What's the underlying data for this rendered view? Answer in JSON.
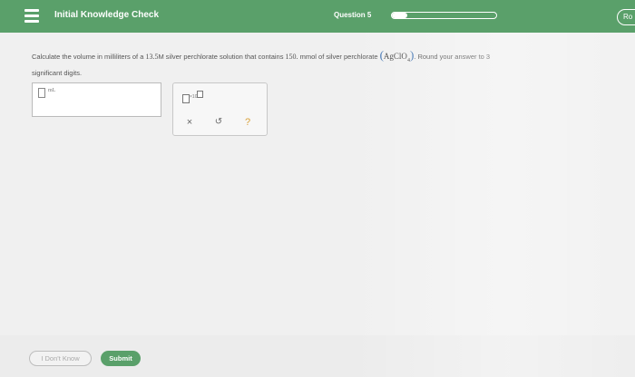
{
  "header": {
    "menu_icon": "hamburger-menu-icon",
    "title": "Initial Knowledge Check",
    "question_label": "Question 5",
    "progress_fraction": 0.15,
    "user_button_label": "Ro",
    "color": "#5aa06a"
  },
  "question": {
    "text_part1": "Calculate the volume in milliliters of a ",
    "concentration": "13.5",
    "text_part2": "M silver perchlorate solution that contains ",
    "amount": "150.",
    "text_part3": " mmol of silver perchlorate ",
    "formula": "AgClO",
    "formula_subscript": "4",
    "text_part4": ". Round your answer to 3",
    "text_line2": "significant digits."
  },
  "answer": {
    "unit": "mL",
    "value": ""
  },
  "tools": {
    "scientific_notation_icon": "x10-power-icon",
    "clear_icon": "×",
    "undo_icon": "↺",
    "help_icon": "?"
  },
  "footer": {
    "dont_know_label": "I Don't Know",
    "submit_label": "Submit"
  }
}
